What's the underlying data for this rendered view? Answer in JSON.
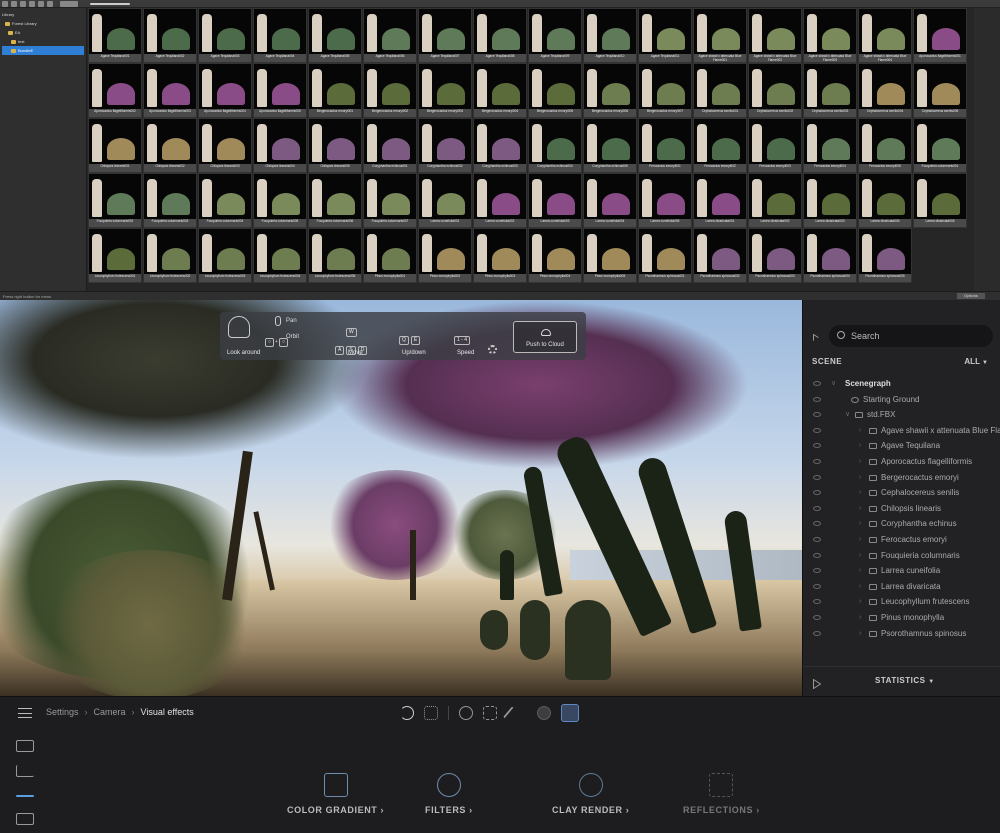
{
  "library": {
    "tree": [
      {
        "label": "Library",
        "selected": false
      },
      {
        "label": "Forest Library",
        "selected": false
      },
      {
        "label": "EA",
        "selected": false
      },
      {
        "label": "test",
        "selected": false
      },
      {
        "label": "BundleE",
        "selected": true
      }
    ],
    "thumbnails": [
      "Agave Tequilana001",
      "Agave Tequilana002",
      "Agave Tequilana003",
      "Agave Tequilana004",
      "Agave Tequilana005",
      "Agave Tequilana006",
      "Agave Tequilana007",
      "Agave Tequilana008",
      "Agave Tequilana009",
      "Agave Tequilana010",
      "Agave Tequilana011",
      "Agave shawii x attenuata Blue Flame001",
      "Agave shawii x attenuata Blue Flame002",
      "Agave shawii x attenuata Blue Flame003",
      "Agave shawii x attenuata Blue Flame004",
      "Aporocactus flagelliformis001",
      "Aporocactus flagelliformis002",
      "Aporocactus flagelliformis003",
      "Aporocactus flagelliformis004",
      "Aporocactus flagelliformis005",
      "Bergerocactus emoryi001",
      "Bergerocactus emoryi002",
      "Bergerocactus emoryi003",
      "Bergerocactus emoryi004",
      "Bergerocactus emoryi005",
      "Bergerocactus emoryi006",
      "Bergerocactus emoryi007",
      "Cephalocereus senilis001",
      "Cephalocereus senilis002",
      "Cephalocereus senilis003",
      "Cephalocereus senilis004",
      "Cephalocereus senilis005",
      "Chilopsis linearis001",
      "Chilopsis linearis002",
      "Chilopsis linearis003",
      "Chilopsis linearis004",
      "Chilopsis linearis005",
      "Coryphantha echinus001",
      "Coryphantha echinus002",
      "Coryphantha echinus003",
      "Coryphantha echinus004",
      "Coryphantha echinus005",
      "Ferocactus emoryi001",
      "Ferocactus emoryi002",
      "Ferocactus emoryi003",
      "Ferocactus emoryi004",
      "Ferocactus emoryi005",
      "Fouquieria columnaris001",
      "Fouquieria columnaris002",
      "Fouquieria columnaris003",
      "Fouquieria columnaris004",
      "Fouquieria columnaris005",
      "Fouquieria columnaris006",
      "Fouquieria columnaris007",
      "Larrea cuneifolia001",
      "Larrea cuneifolia002",
      "Larrea cuneifolia003",
      "Larrea cuneifolia004",
      "Larrea cuneifolia005",
      "Larrea divaricata001",
      "Larrea divaricata002",
      "Larrea divaricata003",
      "Larrea divaricata004",
      "Larrea divaricata005",
      "Leucophyllum frutescens001",
      "Leucophyllum frutescens002",
      "Leucophyllum frutescens003",
      "Leucophyllum frutescens004",
      "Leucophyllum frutescens005",
      "Pinus monophylla001",
      "Pinus monophylla002",
      "Pinus monophylla003",
      "Pinus monophylla004",
      "Pinus monophylla005",
      "Psorothamnus spinosus001",
      "Psorothamnus spinosus002",
      "Psorothamnus spinosus003",
      "Psorothamnus spinosus004",
      "Psorothamnus spinosus005"
    ],
    "status_text": "Press right button for menu",
    "status_button": "Options"
  },
  "navbar": {
    "look_around": "Look around",
    "pan": "Pan",
    "orbit": "Orbit",
    "move": "Move",
    "updown": "Up/down",
    "speed": "Speed",
    "speed_keys": "1 - 4",
    "push_to_cloud": "Push to Cloud"
  },
  "scene_panel": {
    "search_placeholder": "Search",
    "scene_label": "SCENE",
    "filter": "ALL",
    "statistics": "STATISTICS",
    "rows": [
      {
        "label": "Scenegraph",
        "level": 0,
        "chev": "V",
        "folder": false,
        "bold": true
      },
      {
        "label": "Starting Ground",
        "level": 1,
        "chev": "",
        "folder": false,
        "bold": false
      },
      {
        "label": "std.FBX",
        "level": 1,
        "chev": "V",
        "folder": true,
        "bold": false
      },
      {
        "label": "Agave shawii x attenuata Blue Flame",
        "level": 2,
        "chev": ">",
        "folder": true,
        "bold": false
      },
      {
        "label": "Agave Tequilana",
        "level": 2,
        "chev": ">",
        "folder": true,
        "bold": false
      },
      {
        "label": "Aporocactus flagelliformis",
        "level": 2,
        "chev": ">",
        "folder": true,
        "bold": false
      },
      {
        "label": "Bergerocactus emoryi",
        "level": 2,
        "chev": ">",
        "folder": true,
        "bold": false
      },
      {
        "label": "Cephalocereus senilis",
        "level": 2,
        "chev": ">",
        "folder": true,
        "bold": false
      },
      {
        "label": "Chilopsis linearis",
        "level": 2,
        "chev": ">",
        "folder": true,
        "bold": false
      },
      {
        "label": "Coryphantha echinus",
        "level": 2,
        "chev": ">",
        "folder": true,
        "bold": false
      },
      {
        "label": "Ferocactus emoryi",
        "level": 2,
        "chev": ">",
        "folder": true,
        "bold": false
      },
      {
        "label": "Fouquieria columnaris",
        "level": 2,
        "chev": ">",
        "folder": true,
        "bold": false
      },
      {
        "label": "Larrea cuneifolia",
        "level": 2,
        "chev": ">",
        "folder": true,
        "bold": false
      },
      {
        "label": "Larrea divaricata",
        "level": 2,
        "chev": ">",
        "folder": true,
        "bold": false
      },
      {
        "label": "Leucophyllum frutescens",
        "level": 2,
        "chev": ">",
        "folder": true,
        "bold": false
      },
      {
        "label": "Pinus monophylla",
        "level": 2,
        "chev": ">",
        "folder": true,
        "bold": false
      },
      {
        "label": "Psorothamnus spinosus",
        "level": 2,
        "chev": ">",
        "folder": true,
        "bold": false
      }
    ]
  },
  "bottom": {
    "breadcrumb": [
      "Settings",
      "Camera",
      "Visual effects"
    ],
    "effects": [
      {
        "label": "COLOR GRADIENT",
        "icon": "color-gradient-icon",
        "dim": false
      },
      {
        "label": "FILTERS",
        "icon": "filters-icon",
        "dim": false
      },
      {
        "label": "CLAY RENDER",
        "icon": "clay-render-icon",
        "dim": false
      },
      {
        "label": "REFLECTIONS",
        "icon": "reflections-icon",
        "dim": true
      }
    ]
  },
  "colors": {
    "accent": "#2f7fd6",
    "panel_bg": "#222224",
    "active_tool": "#3d4f6e"
  }
}
